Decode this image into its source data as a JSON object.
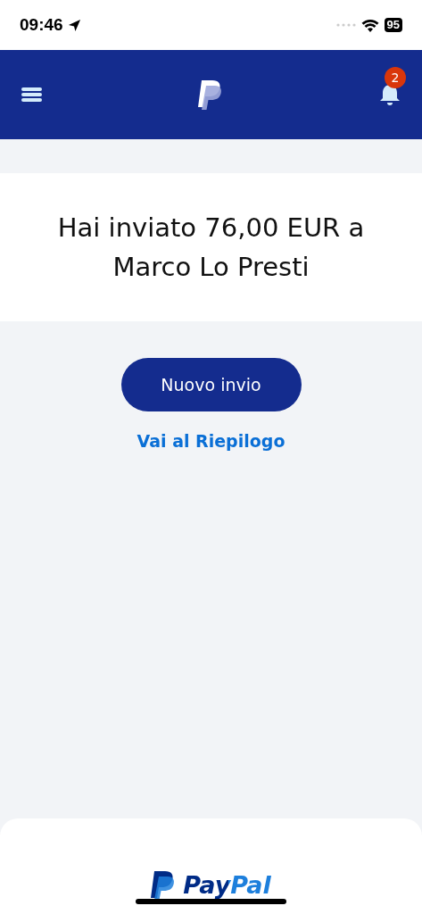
{
  "status_bar": {
    "time": "09:46",
    "battery": "95"
  },
  "header": {
    "notification_count": "2"
  },
  "confirmation": {
    "message": "Hai inviato 76,00 EUR a Marco Lo Presti"
  },
  "actions": {
    "primary_button": "Nuovo invio",
    "link": "Vai al Riepilogo"
  },
  "footer": {
    "brand": "PayPal"
  }
}
